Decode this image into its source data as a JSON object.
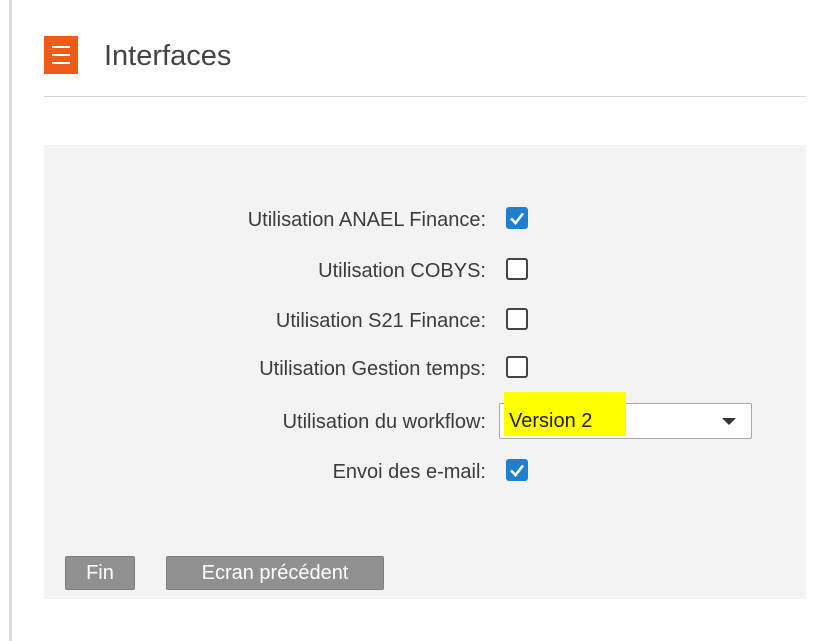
{
  "header": {
    "title": "Interfaces",
    "menu_icon": "hamburger-menu-icon"
  },
  "form": {
    "rows": [
      {
        "label": "Utilisation ANAEL Finance:",
        "type": "checkbox",
        "checked": true
      },
      {
        "label": "Utilisation COBYS:",
        "type": "checkbox",
        "checked": false
      },
      {
        "label": "Utilisation S21 Finance:",
        "type": "checkbox",
        "checked": false
      },
      {
        "label": "Utilisation Gestion temps:",
        "type": "checkbox",
        "checked": false
      },
      {
        "label": "Utilisation du workflow:",
        "type": "select",
        "value": "Version 2"
      },
      {
        "label": "Envoi des e-mail:",
        "type": "checkbox",
        "checked": true
      }
    ]
  },
  "buttons": {
    "fin": "Fin",
    "previous": "Ecran précédent"
  },
  "colors": {
    "accent": "#f05a1a",
    "checkbox_checked": "#1e7fd1",
    "highlight": "#ffff00",
    "button": "#909090"
  }
}
